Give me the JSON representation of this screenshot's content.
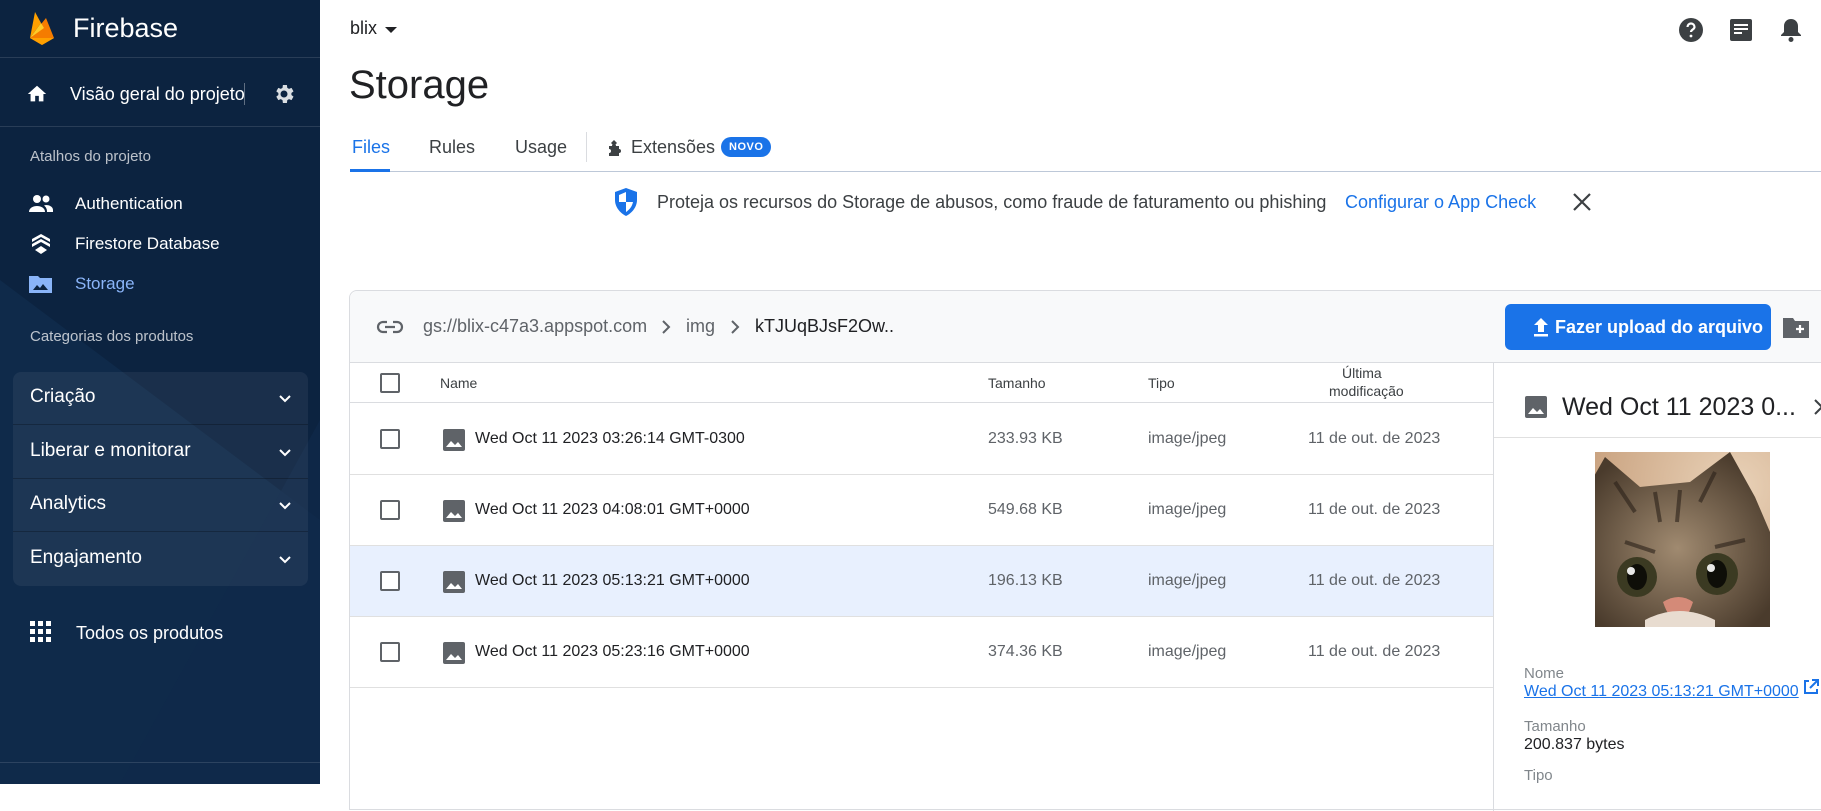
{
  "app": {
    "name": "Firebase"
  },
  "sidebar": {
    "overview_label": "Visão geral do projeto",
    "shortcuts_title": "Atalhos do projeto",
    "shortcuts": [
      {
        "label": "Authentication",
        "icon": "people-icon"
      },
      {
        "label": "Firestore Database",
        "icon": "firestore-icon"
      },
      {
        "label": "Storage",
        "icon": "storage-folder-icon",
        "active": true
      }
    ],
    "categories_title": "Categorias dos produtos",
    "categories": [
      {
        "label": "Criação"
      },
      {
        "label": "Liberar e monitorar"
      },
      {
        "label": "Analytics"
      },
      {
        "label": "Engajamento"
      }
    ],
    "all_products_label": "Todos os produtos"
  },
  "topbar": {
    "project": "blix"
  },
  "page": {
    "title": "Storage"
  },
  "tabs": [
    {
      "label": "Files",
      "active": true
    },
    {
      "label": "Rules"
    },
    {
      "label": "Usage"
    },
    {
      "label": "Extensões",
      "badge": "NOVO"
    }
  ],
  "banner": {
    "text": "Proteja os recursos do Storage de abusos, como fraude de faturamento ou phishing",
    "link": "Configurar o App Check"
  },
  "path": {
    "crumbs": [
      "gs://blix-c47a3.appspot.com",
      "img",
      "kTJUqBJsF2Ow.."
    ]
  },
  "upload_button": "Fazer upload do arquivo",
  "table": {
    "columns": {
      "name": "Name",
      "size": "Tamanho",
      "type": "Tipo",
      "modified_line1": "Última",
      "modified_line2": "modificação"
    },
    "rows": [
      {
        "name": "Wed Oct 11 2023 03:26:14 GMT-0300",
        "size": "233.93 KB",
        "type": "image/jpeg",
        "modified": "11 de out. de 2023"
      },
      {
        "name": "Wed Oct 11 2023 04:08:01 GMT+0000",
        "size": "549.68 KB",
        "type": "image/jpeg",
        "modified": "11 de out. de 2023"
      },
      {
        "name": "Wed Oct 11 2023 05:13:21 GMT+0000",
        "size": "196.13 KB",
        "type": "image/jpeg",
        "modified": "11 de out. de 2023",
        "selected": true
      },
      {
        "name": "Wed Oct 11 2023 05:23:16 GMT+0000",
        "size": "374.36 KB",
        "type": "image/jpeg",
        "modified": "11 de out. de 2023"
      }
    ]
  },
  "detail": {
    "title": "Wed Oct 11 2023 0...",
    "name_label": "Nome",
    "name_value": "Wed Oct 11 2023 05:13:21 GMT+0000",
    "size_label": "Tamanho",
    "size_value": "200.837 bytes",
    "type_label": "Tipo"
  },
  "colors": {
    "sidebar": "#0c2340",
    "accent": "#1a73e8",
    "selected_row": "#e8f0fe"
  }
}
